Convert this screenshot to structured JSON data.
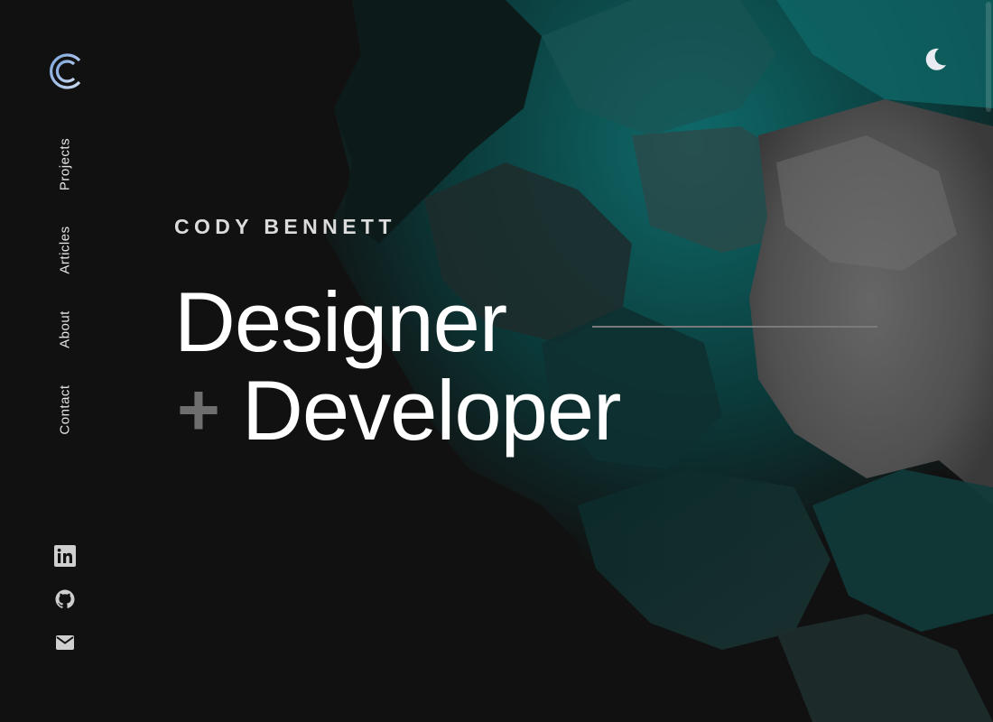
{
  "brand": {
    "logo_letter": "C",
    "colors": {
      "logo_start": "#7ea6de",
      "logo_end": "#c9d8f2"
    }
  },
  "nav": {
    "items": [
      {
        "label": "Projects"
      },
      {
        "label": "Articles"
      },
      {
        "label": "About"
      },
      {
        "label": "Contact"
      }
    ]
  },
  "social": {
    "items": [
      {
        "icon": "linkedin-icon"
      },
      {
        "icon": "github-icon"
      },
      {
        "icon": "mail-icon"
      }
    ]
  },
  "theme_toggle": {
    "icon": "moon-icon"
  },
  "hero": {
    "intro": "CODY BENNETT",
    "title_line_1": "Designer",
    "plus": "+",
    "title_line_2": "Developer"
  },
  "colors": {
    "background": "#111111",
    "text": "#ffffff",
    "accent_teal": "#0d5f5f",
    "accent_grey": "#5a5a5a"
  }
}
